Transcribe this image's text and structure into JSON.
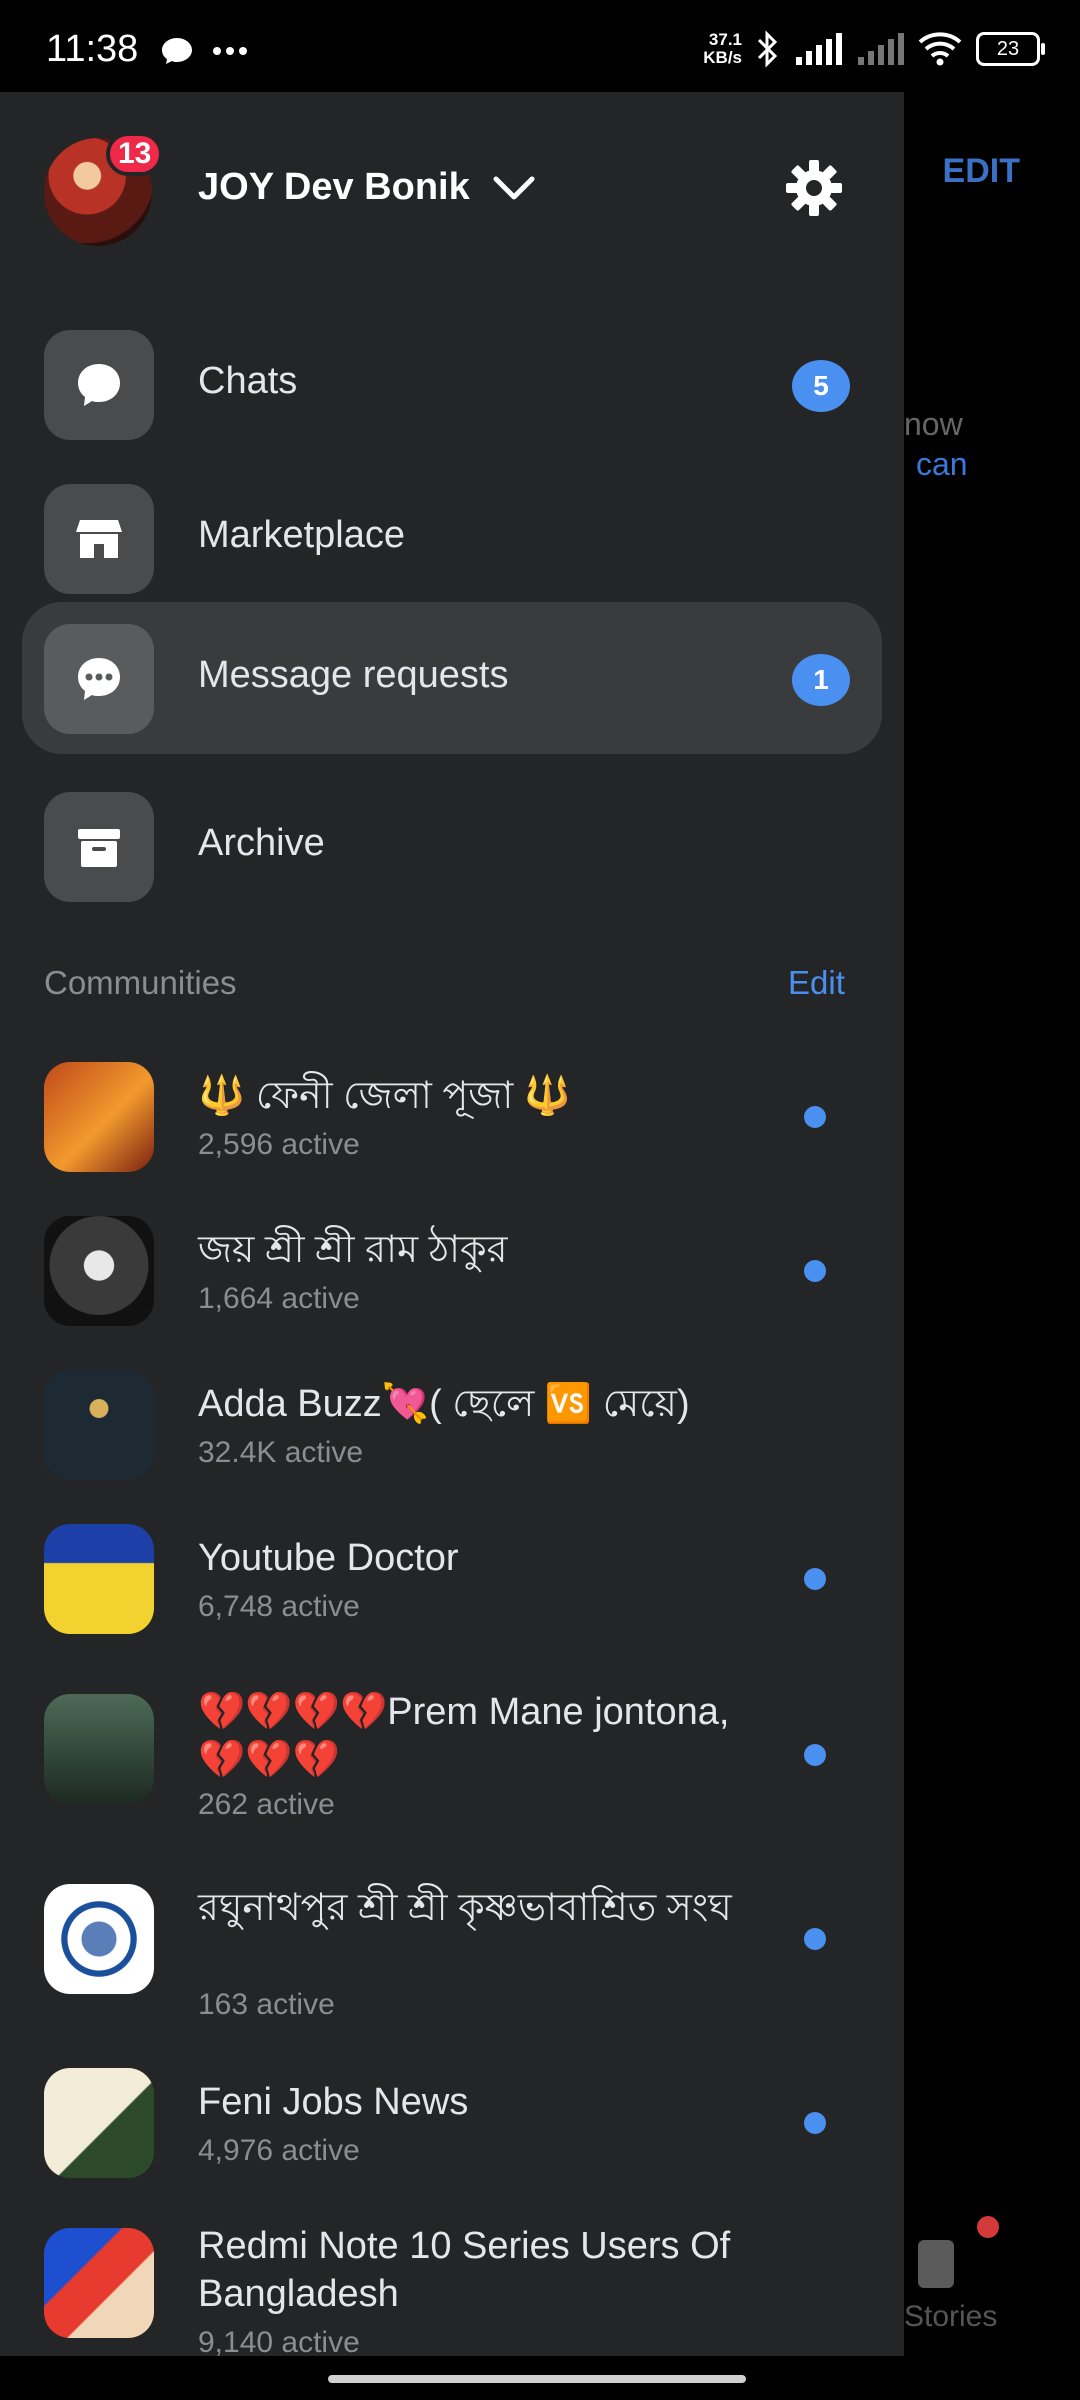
{
  "status_bar": {
    "time": "11:38",
    "net_speed_top": "37.1",
    "net_speed_bottom": "KB/s",
    "battery": "23",
    "icons": [
      "messenger-bubble-icon",
      "more-dots-icon",
      "bluetooth-icon",
      "signal-icon",
      "signal-icon",
      "wifi-icon",
      "battery-icon"
    ]
  },
  "background_app": {
    "edit": "EDIT",
    "text1": "now",
    "text2": "can",
    "stories": "Stories"
  },
  "profile": {
    "name": "JOY Dev Bonik",
    "notification_count": "13"
  },
  "menu": [
    {
      "label": "Chats",
      "badge": "5",
      "icon": "chat-bubble-icon"
    },
    {
      "label": "Marketplace",
      "badge": "",
      "icon": "storefront-icon"
    },
    {
      "label": "Message requests",
      "badge": "1",
      "icon": "message-request-icon"
    },
    {
      "label": "Archive",
      "badge": "",
      "icon": "archive-box-icon"
    }
  ],
  "communities": {
    "header": "Communities",
    "edit": "Edit",
    "items": [
      {
        "name": "🔱 ফেনী জেলা পূজা 🔱",
        "active": "2,596 active"
      },
      {
        "name": "জয় শ্রী শ্রী রাম ঠাকুর",
        "active": "1,664 active"
      },
      {
        "name": "Adda Buzz💘( ছেলে 🆚 মেয়ে)",
        "active": "32.4K active"
      },
      {
        "name": "Youtube Doctor",
        "active": "6,748 active"
      },
      {
        "name": "💔💔💔💔Prem Mane jontona,💔💔💔",
        "active": "262 active"
      },
      {
        "name": "রঘুনাথপুর শ্রী শ্রী কৃষ্ণভাবাশ্রিত সংঘ",
        "active": "163 active"
      },
      {
        "name": "Feni Jobs News",
        "active": "4,976 active"
      },
      {
        "name": "Redmi Note 10 Series Users Of Bangladesh",
        "active": "9,140 active"
      }
    ]
  },
  "colors": {
    "drawer_bg": "#242526",
    "accent": "#4a90f0",
    "badge_red": "#f02849"
  }
}
